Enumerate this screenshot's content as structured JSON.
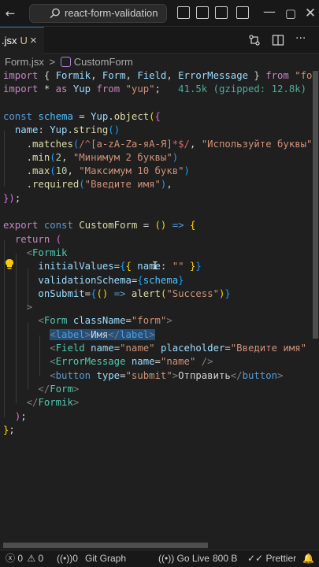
{
  "titlebar": {
    "search_text": "react-form-validation"
  },
  "tab": {
    "filename": ".jsx",
    "modified": "U",
    "close": "×"
  },
  "breadcrumb": {
    "file": "Form.jsx",
    "separator1": ">",
    "separator2": ">",
    "symbol": "CustomForm"
  },
  "code": {
    "l1": {
      "k1": "import",
      "p1": " { ",
      "v1": "Formik",
      "p2": ", ",
      "v2": "Form",
      "p3": ", ",
      "v3": "Field",
      "p4": ", ",
      "v4": "ErrorMessage",
      "p5": " } ",
      "k2": "from",
      "sp": " ",
      "s1": "\"formik\""
    },
    "l2": {
      "k1": "import",
      "p1": " * ",
      "k2": "as",
      "sp": " ",
      "v1": "Yup",
      "sp2": " ",
      "k3": "from",
      "sp3": " ",
      "s1": "\"yup\"",
      "p2": ";",
      "hint": "   41.5k (gzipped: 12.8k)"
    },
    "l4": {
      "k1": "const",
      "sp": " ",
      "v1": "schema",
      "p1": " = ",
      "v2": "Yup",
      "p2": ".",
      "f1": "object",
      "b1": "(",
      "b2": "{"
    },
    "l5": {
      "indent": "  ",
      "v1": "name",
      "p1": ": ",
      "v2": "Yup",
      "p2": ".",
      "f1": "string",
      "b1": "()"
    },
    "l6": {
      "indent": "    .",
      "f1": "matches",
      "b1": "(",
      "r1": "/^",
      "r2": "[a-zA-Za-яА-Я]",
      "r3": "*$/",
      "p1": ", ",
      "s1": "\"Используйте буквы\"",
      "b2": ")"
    },
    "l7": {
      "indent": "    .",
      "f1": "min",
      "b1": "(",
      "n1": "2",
      "p1": ", ",
      "s1": "\"Минимум 2 буквы\"",
      "b2": ")"
    },
    "l8": {
      "indent": "    .",
      "f1": "max",
      "b1": "(",
      "n1": "10",
      "p1": ", ",
      "s1": "\"Максимум 10 букв\"",
      "b2": ")"
    },
    "l9": {
      "indent": "    .",
      "f1": "required",
      "b1": "(",
      "s1": "\"Введите имя\"",
      "b2": ")",
      "p1": ","
    },
    "l10": {
      "b1": "})",
      "p1": ";"
    },
    "l12": {
      "k1": "export",
      "sp": " ",
      "k2": "const",
      "sp2": " ",
      "f1": "CustomForm",
      "p1": " = ",
      "b1": "()",
      "sp3": " ",
      "k3": "=>",
      "sp4": " ",
      "b2": "{"
    },
    "l13": {
      "indent": "  ",
      "k1": "return",
      "sp": " ",
      "b1": "("
    },
    "l14": {
      "indent": "    ",
      "t1": "<",
      "t2": "Formik"
    },
    "l15": {
      "indent": "      ",
      "a1": "initialValues",
      "p1": "=",
      "b1": "{",
      "b2": "{",
      "sp": " ",
      "a2": "name",
      "p2": ": ",
      "s1": "\"\"",
      "sp2": " ",
      "b3": "}",
      "b4": "}"
    },
    "l16": {
      "indent": "      ",
      "a1": "validationSchema",
      "p1": "=",
      "b1": "{",
      "v1": "schema",
      "b2": "}"
    },
    "l17": {
      "indent": "      ",
      "a1": "onSubmit",
      "p1": "=",
      "b1": "{",
      "b2": "()",
      "sp": " ",
      "k1": "=>",
      "sp2": " ",
      "f1": "alert",
      "b3": "(",
      "s1": "\"Success\"",
      "b4": ")",
      "b5": "}"
    },
    "l18": {
      "indent": "    ",
      "t1": ">"
    },
    "l19": {
      "indent": "      ",
      "t1": "<",
      "t2": "Form",
      "sp": " ",
      "a1": "className",
      "p1": "=",
      "s1": "\"form\"",
      "t3": ">"
    },
    "l20": {
      "indent": "        ",
      "t1": "<",
      "t2": "label",
      "t3": ">",
      "txt": "Имя",
      "t4": "</",
      "t5": "label",
      "t6": ">"
    },
    "l21": {
      "indent": "        ",
      "t1": "<",
      "t2": "Field",
      "sp": " ",
      "a1": "name",
      "p1": "=",
      "s1": "\"name\"",
      "sp2": " ",
      "a2": "placeholder",
      "p2": "=",
      "s2": "\"Введите имя\"",
      "t3": " />"
    },
    "l22": {
      "indent": "        ",
      "t1": "<",
      "t2": "ErrorMessage",
      "sp": " ",
      "a1": "name",
      "p1": "=",
      "s1": "\"name\"",
      "t3": " />"
    },
    "l23": {
      "indent": "        ",
      "t1": "<",
      "t2": "button",
      "sp": " ",
      "a1": "type",
      "p1": "=",
      "s1": "\"submit\"",
      "t3": ">",
      "txt": "Отправить",
      "t4": "</",
      "t5": "button",
      "t6": ">"
    },
    "l24": {
      "indent": "      ",
      "t1": "</",
      "t2": "Form",
      "t3": ">"
    },
    "l25": {
      "indent": "    ",
      "t1": "</",
      "t2": "Formik",
      "t3": ">"
    },
    "l26": {
      "indent": "  ",
      "b1": ")",
      "p1": ";"
    },
    "l27": {
      "b1": "}",
      "p1": ";"
    }
  },
  "statusbar": {
    "errors": "0",
    "warnings": "0",
    "ports": "0",
    "git_graph": "Git Graph",
    "go_live": "Go Live",
    "size": "800 B",
    "prettier": "Prettier"
  },
  "colors": {
    "accent": "#0078d4",
    "background": "#1f1f1f"
  }
}
